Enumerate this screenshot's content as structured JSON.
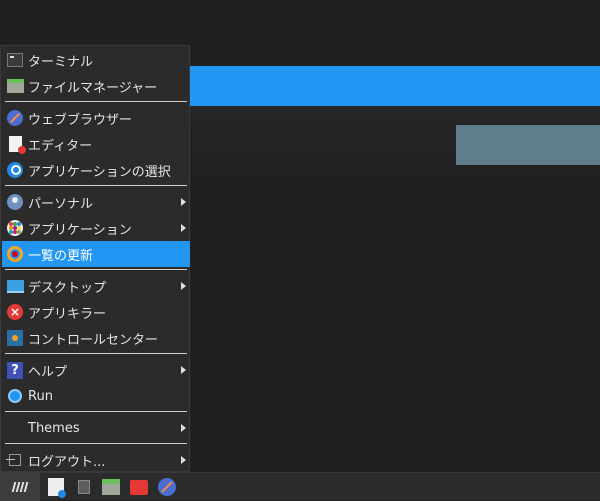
{
  "menu": {
    "items": [
      {
        "id": "terminal",
        "label": "ターミナル",
        "icon": "terminal-icon"
      },
      {
        "id": "file-manager",
        "label": "ファイルマネージャー",
        "icon": "file-manager-icon"
      },
      {
        "id": "web-browser",
        "label": "ウェブブラウザー",
        "icon": "web-browser-icon"
      },
      {
        "id": "editor",
        "label": "エディター",
        "icon": "text-editor-icon"
      },
      {
        "id": "app-finder",
        "label": "アプリケーションの選択",
        "icon": "search-icon"
      },
      {
        "id": "personal",
        "label": "パーソナル",
        "icon": "user-icon",
        "submenu": true
      },
      {
        "id": "applications",
        "label": "アプリケーション",
        "icon": "apps-grid-icon",
        "submenu": true
      },
      {
        "id": "refresh-list",
        "label": "一覧の更新",
        "icon": "refresh-icon",
        "active": true
      },
      {
        "id": "desktop",
        "label": "デスクトップ",
        "icon": "desktop-icon",
        "submenu": true
      },
      {
        "id": "app-killer",
        "label": "アプリキラー",
        "icon": "close-icon"
      },
      {
        "id": "control-center",
        "label": "コントロールセンター",
        "icon": "control-center-icon"
      },
      {
        "id": "help",
        "label": "ヘルプ",
        "icon": "help-icon",
        "submenu": true
      },
      {
        "id": "run",
        "label": "Run",
        "icon": "run-icon"
      },
      {
        "id": "themes",
        "label": "Themes",
        "submenu": true
      },
      {
        "id": "logout",
        "label": "ログアウト...",
        "icon": "logout-icon",
        "submenu": true
      }
    ]
  },
  "taskbar": {
    "items": [
      "menu-launcher-icon",
      "software-store-icon",
      "eject-icon",
      "file-manager-icon",
      "folder-icon",
      "web-browser-icon"
    ]
  },
  "colors": {
    "accent": "#2196f3",
    "window_secondary": "#607d8b",
    "menu_bg": "#2b2b2b",
    "desktop_bg": "#202020"
  }
}
